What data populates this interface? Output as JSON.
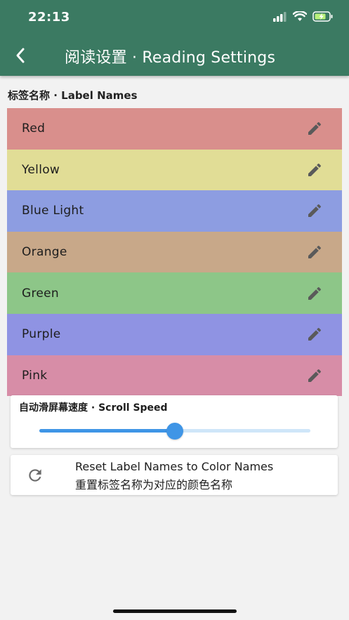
{
  "status_bar": {
    "time": "22:13"
  },
  "header": {
    "title": "阅读设置 · Reading Settings",
    "back_icon": "chevron-left-icon"
  },
  "label_names": {
    "title": "标签名称 · Label Names",
    "items": [
      {
        "label": "Red",
        "color": "#d98f8c"
      },
      {
        "label": "Yellow",
        "color": "#e1dd96"
      },
      {
        "label": "Blue Light",
        "color": "#8d9de1"
      },
      {
        "label": "Orange",
        "color": "#c8a889"
      },
      {
        "label": "Green",
        "color": "#8dc688"
      },
      {
        "label": "Purple",
        "color": "#8f93e3"
      },
      {
        "label": "Pink",
        "color": "#d78da7"
      }
    ],
    "edit_icon": "pencil-icon"
  },
  "scroll_speed": {
    "title": "自动滑屏幕速度 · Scroll Speed",
    "value_fraction": 0.5,
    "accent": "#3f95e6"
  },
  "reset": {
    "line1": "Reset Label Names to Color Names",
    "line2": "重置标签名称为对应的颜色名称",
    "icon": "refresh-icon"
  },
  "colors": {
    "app_bar": "#3b7a62",
    "background": "#f2f2f2"
  }
}
